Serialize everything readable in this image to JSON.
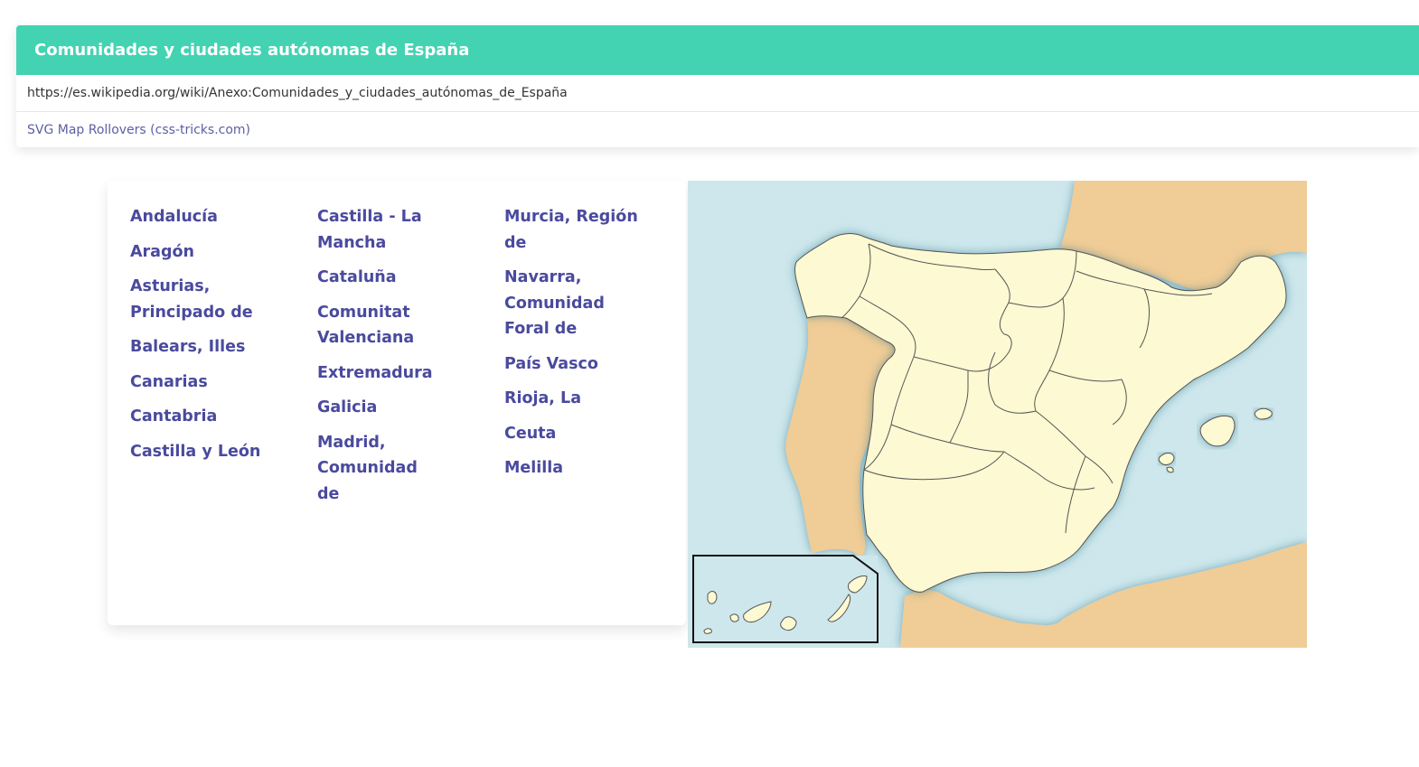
{
  "header": {
    "title": "Comunidades y ciudades autónomas de España",
    "url": "https://es.wikipedia.org/wiki/Anexo:Comunidades_y_ciudades_autónomas_de_España",
    "link_label": "SVG Map Rollovers (css-tricks.com)"
  },
  "regions": {
    "col1": [
      "Andalucía",
      "Aragón",
      "Asturias, Principado de",
      "Balears, Illes",
      "Canarias",
      "Cantabria",
      "Castilla y León"
    ],
    "col2": [
      "Castilla - La Mancha",
      "Cataluña",
      "Comunitat Valenciana",
      "Extremadura",
      "Galicia",
      "Madrid, Comunidad de"
    ],
    "col3": [
      "Murcia, Región de",
      "Navarra, Comunidad Foral de",
      "País Vasco",
      "Rioja, La",
      "Ceuta",
      "Melilla"
    ]
  },
  "map": {
    "colors": {
      "sea": "#cde7ec",
      "land_other": "#f0cc96",
      "spain": "#fdf9d2",
      "border": "#555555",
      "header_accent": "#43d3b2",
      "link": "#4a4a9e"
    }
  }
}
